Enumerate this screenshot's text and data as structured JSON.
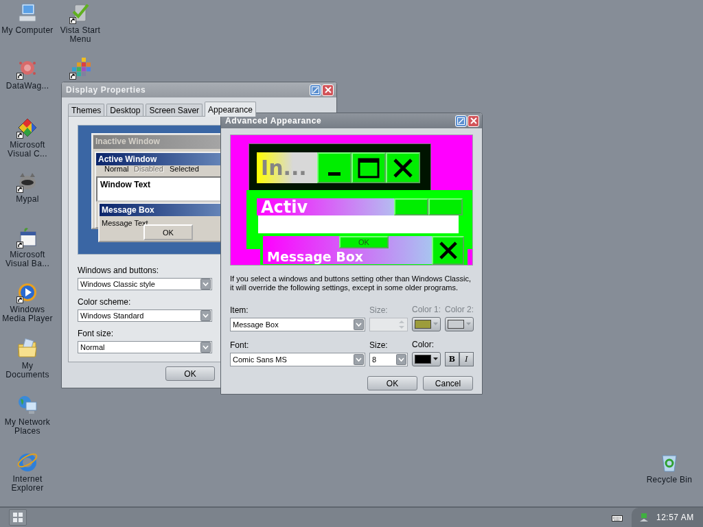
{
  "desktop_icons": [
    {
      "label": "My Computer",
      "shortcut": false
    },
    {
      "label": "DataWag...",
      "shortcut": true
    },
    {
      "label": "Microsoft Visual C...",
      "shortcut": true
    },
    {
      "label": "Mypal",
      "shortcut": true
    },
    {
      "label": "Microsoft Visual Ba...",
      "shortcut": true
    },
    {
      "label": "Windows Media Player",
      "shortcut": true
    },
    {
      "label": "My Documents",
      "shortcut": false
    },
    {
      "label": "My Network Places",
      "shortcut": false
    },
    {
      "label": "Internet Explorer",
      "shortcut": false
    },
    {
      "label": "Vista Start Menu",
      "shortcut": true
    },
    {
      "shortcut": true
    },
    {
      "label": "Recycle Bin",
      "shortcut": false
    }
  ],
  "display_properties": {
    "title": "Display Properties",
    "tabs": [
      {
        "label": "Themes",
        "selected": false
      },
      {
        "label": "Desktop",
        "selected": false
      },
      {
        "label": "Screen Saver",
        "selected": false
      },
      {
        "label": "Appearance",
        "selected": true
      }
    ],
    "preview": {
      "inactive_title": "Inactive Window",
      "active_title": "Active Window",
      "menu": [
        {
          "label": "Normal",
          "disabled": false
        },
        {
          "label": "Disabled",
          "disabled": true
        },
        {
          "label": "Selected",
          "disabled": false
        }
      ],
      "window_text": "Window Text",
      "message_title": "Message Box",
      "message_text": "Message Text",
      "button": "OK"
    },
    "fields": [
      {
        "label": "Windows and buttons:",
        "value": "Windows Classic style"
      },
      {
        "label": "Color scheme:",
        "value": "Windows Standard"
      },
      {
        "label": "Font size:",
        "value": "Normal"
      }
    ],
    "buttons": [
      "OK"
    ]
  },
  "advanced_appearance": {
    "title": "Advanced Appearance",
    "preview": {
      "inactive_title": "In...",
      "active_title": "Activ",
      "message_title": "Message Box",
      "button": "OK"
    },
    "note": "If you select a windows and buttons setting other than Windows Classic, it will override the following settings, except in some older programs.",
    "item": {
      "label": "Item:",
      "value": "Message Box"
    },
    "item_size": {
      "label": "Size:",
      "disabled": true
    },
    "color_1": {
      "label": "Color 1:",
      "disabled": true,
      "color": "#9c9c3c"
    },
    "color_2": {
      "label": "Color 2:",
      "disabled": true,
      "color": "#c8ccd0"
    },
    "font": {
      "label": "Font:",
      "value": "Comic Sans MS"
    },
    "font_size": {
      "label": "Size:",
      "value": "8"
    },
    "font_color": {
      "label": "Color:",
      "color": "#000000"
    },
    "style_buttons": [
      {
        "label": "B",
        "kind": "bold",
        "pressed": false
      },
      {
        "label": "I",
        "kind": "italic",
        "pressed": false
      }
    ],
    "buttons": [
      "OK",
      "Cancel"
    ]
  },
  "taskbar": {
    "clock": "12:57 AM"
  }
}
